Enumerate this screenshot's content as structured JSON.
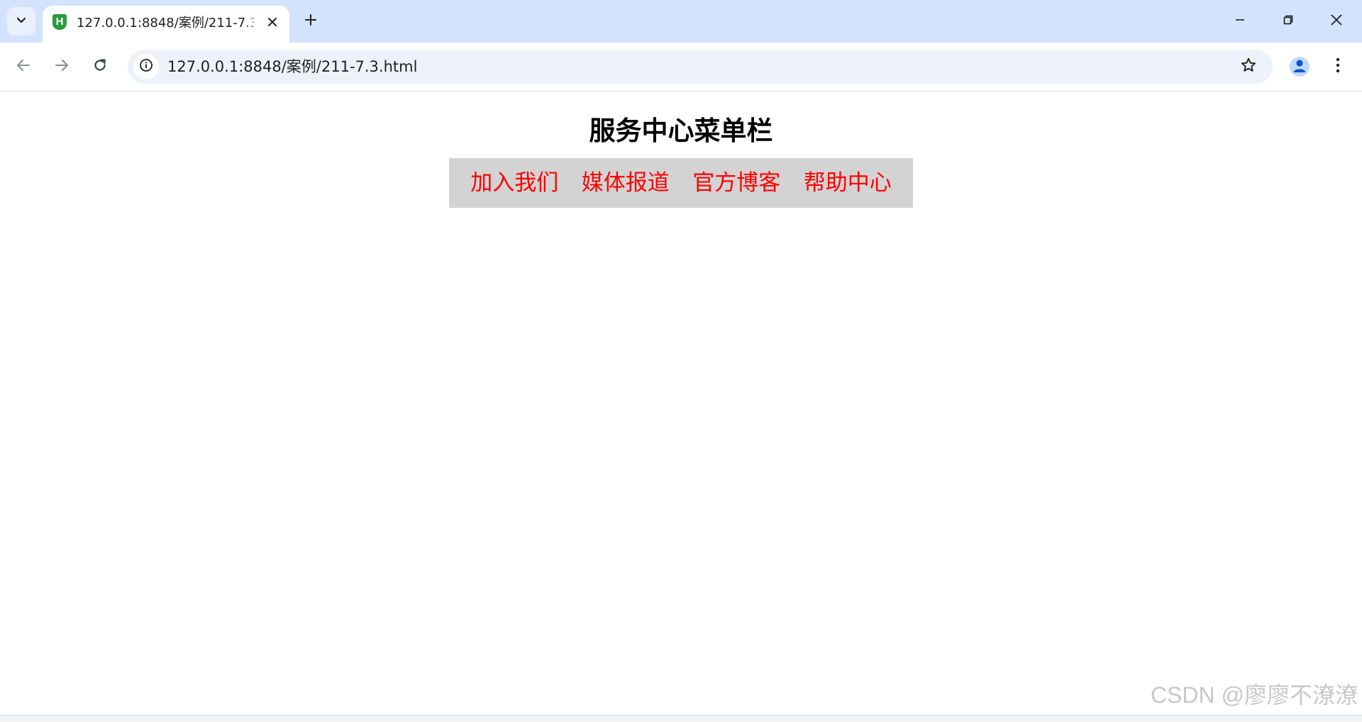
{
  "browser": {
    "tab": {
      "favicon_letter": "H",
      "title": "127.0.0.1:8848/案例/211-7.3.html"
    },
    "address_bar": {
      "url": "127.0.0.1:8848/案例/211-7.3.html"
    }
  },
  "page": {
    "heading": "服务中心菜单栏",
    "menu": [
      {
        "label": "加入我们"
      },
      {
        "label": "媒体报道"
      },
      {
        "label": "官方博客"
      },
      {
        "label": "帮助中心"
      }
    ],
    "link_color": "#ff0000",
    "menu_background": "#d3d3d3"
  },
  "watermark": "CSDN @廖廖不潦潦"
}
